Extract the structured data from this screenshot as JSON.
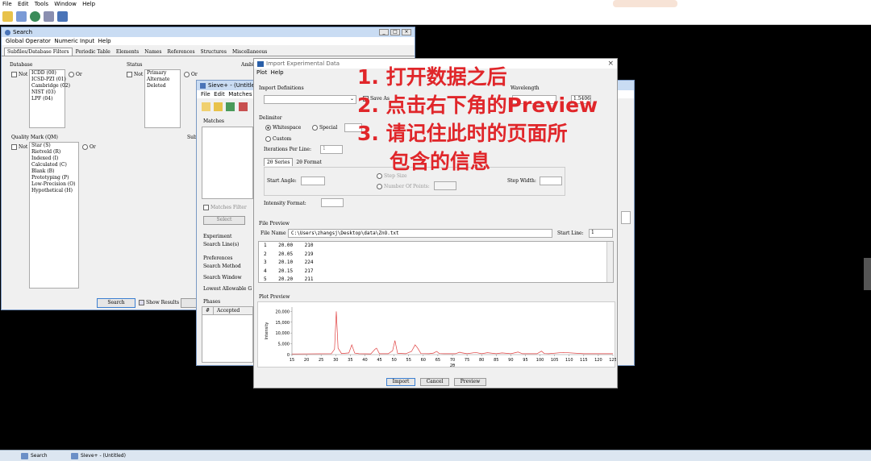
{
  "app": {
    "menu": [
      "File",
      "Edit",
      "Tools",
      "Window",
      "Help"
    ],
    "toolbar_icons": [
      "open-icon",
      "report-icon",
      "globe-icon",
      "tools-icon",
      "database-icon"
    ]
  },
  "search_window": {
    "title": "Search",
    "menu": [
      "Global Operator",
      "Numeric Input",
      "Help"
    ],
    "tabs": [
      "Subfiles/Database Filters",
      "Periodic Table",
      "Elements",
      "Names",
      "References",
      "Structures",
      "Miscellaneous"
    ],
    "database_label": "Database",
    "status_label": "Status",
    "ambient_label": "Ambi",
    "not_label": "Not",
    "or_label": "Or",
    "database_items": [
      "ICDD (00)",
      "ICSD-PZI (01)",
      "Cambridge (02)",
      "NIST (03)",
      "LPF (04)"
    ],
    "status_items": [
      "Primary",
      "Alternate",
      "Deleted"
    ],
    "quality_label": "Quality Mark (QM)",
    "sub_label": "Sub",
    "quality_items": [
      "Star (S)",
      "Rietveld (R)",
      "Indexed (I)",
      "Calculated (C)",
      "Blank (B)",
      "Prototyping (P)",
      "Low-Precision (O)",
      "Hypothetical (H)"
    ],
    "search_button": "Search",
    "show_results_label": "Show Results"
  },
  "sieve_window": {
    "title": "Sieve+ - (Untitled)",
    "menu": [
      "File",
      "Edit",
      "Matches"
    ],
    "matches_label": "Matches",
    "matches_filter_label": "Matches Filter",
    "select_button": "Select",
    "experiment_label": "Experiment",
    "search_lines_label": "Search Line(s)",
    "preferences_label": "Preferences",
    "search_method_label": "Search Method",
    "search_window_label": "Search Window",
    "lowest_allowable_label": "Lowest Allowable G",
    "phases_label": "Phases",
    "phases_columns": [
      "#",
      "Accepted"
    ]
  },
  "import_dialog": {
    "title": "Import Experimental Data",
    "menu": [
      "Plot",
      "Help"
    ],
    "import_definitions_label": "Import Definitions",
    "save_as_label": "Save As",
    "wavelength_label": "Wavelength",
    "wavelength_value": "1.5406",
    "delimiter_label": "Delimiter",
    "whitespace_label": "Whitespace",
    "special_label": "Special",
    "custom_label": "Custom",
    "iterations_label": "Iterations Per Line:",
    "iterations_value": "1",
    "tab_2theta_series": "2θ Series",
    "tab_2theta_format": "2θ Format",
    "start_angle_label": "Start Angle:",
    "step_size_label": "Step Size",
    "number_of_points_label": "Number Of Points:",
    "step_width_label": "Step Width:",
    "intensity_format_label": "Intensity Format:",
    "file_preview_label": "File Preview",
    "file_name_label": "File Name",
    "file_name_value": "C:\\Users\\zhangsj\\Desktop\\data\\ZnO.txt",
    "start_line_label": "Start Line:",
    "start_line_value": "1",
    "preview_rows": [
      {
        "n": "1",
        "x": "20.00",
        "y": "210"
      },
      {
        "n": "2",
        "x": "20.05",
        "y": "219"
      },
      {
        "n": "3",
        "x": "20.10",
        "y": "224"
      },
      {
        "n": "4",
        "x": "20.15",
        "y": "217"
      },
      {
        "n": "5",
        "x": "20.20",
        "y": "211"
      }
    ],
    "plot_preview_label": "Plot Preview",
    "import_button": "Import",
    "cancel_button": "Cancel",
    "preview_button": "Preview"
  },
  "chart_data": {
    "type": "line",
    "title": "",
    "xlabel": "2θ",
    "ylabel": "Intensity",
    "xlim": [
      15,
      125
    ],
    "ylim": [
      0,
      22000
    ],
    "x_ticks": [
      15,
      20,
      25,
      30,
      35,
      40,
      45,
      50,
      55,
      60,
      65,
      70,
      75,
      80,
      85,
      90,
      95,
      100,
      105,
      110,
      115,
      120,
      125
    ],
    "y_ticks": [
      0,
      5000,
      10000,
      15000,
      20000
    ],
    "y_tick_labels": [
      "0",
      "5,000",
      "10,000",
      "15,000",
      "20,000"
    ],
    "series": [
      {
        "color": "#e04040",
        "x": [
          15,
          28.5,
          29.6,
          30.2,
          30.8,
          32,
          34.5,
          35.5,
          36.5,
          38,
          42,
          43.5,
          44,
          45,
          48,
          49.5,
          50.3,
          51.2,
          54,
          56,
          57.2,
          58,
          59.2,
          62,
          63.5,
          64.6,
          65.5,
          67,
          71,
          72.5,
          73,
          75,
          78,
          80,
          82,
          85,
          87,
          90,
          91.5,
          92.5,
          94,
          96,
          99,
          100.5,
          101.5,
          103,
          108,
          115,
          125
        ],
        "y": [
          300,
          400,
          2500,
          20000,
          3000,
          500,
          800,
          4500,
          700,
          400,
          350,
          2500,
          3000,
          400,
          400,
          1800,
          6500,
          600,
          400,
          1500,
          4500,
          3200,
          500,
          400,
          700,
          1500,
          500,
          400,
          400,
          1100,
          900,
          400,
          1000,
          400,
          900,
          400,
          800,
          400,
          900,
          1200,
          400,
          400,
          400,
          1600,
          500,
          400,
          1000,
          400,
          400
        ]
      }
    ]
  },
  "annotation": {
    "lines": [
      "1. 打开数据之后",
      "2. 点击右下角的Preview",
      "3. 请记住此时的页面所",
      "包含的信息"
    ]
  },
  "taskbar": {
    "items": [
      "Search",
      "SIeve+ - (Untitled)"
    ]
  }
}
